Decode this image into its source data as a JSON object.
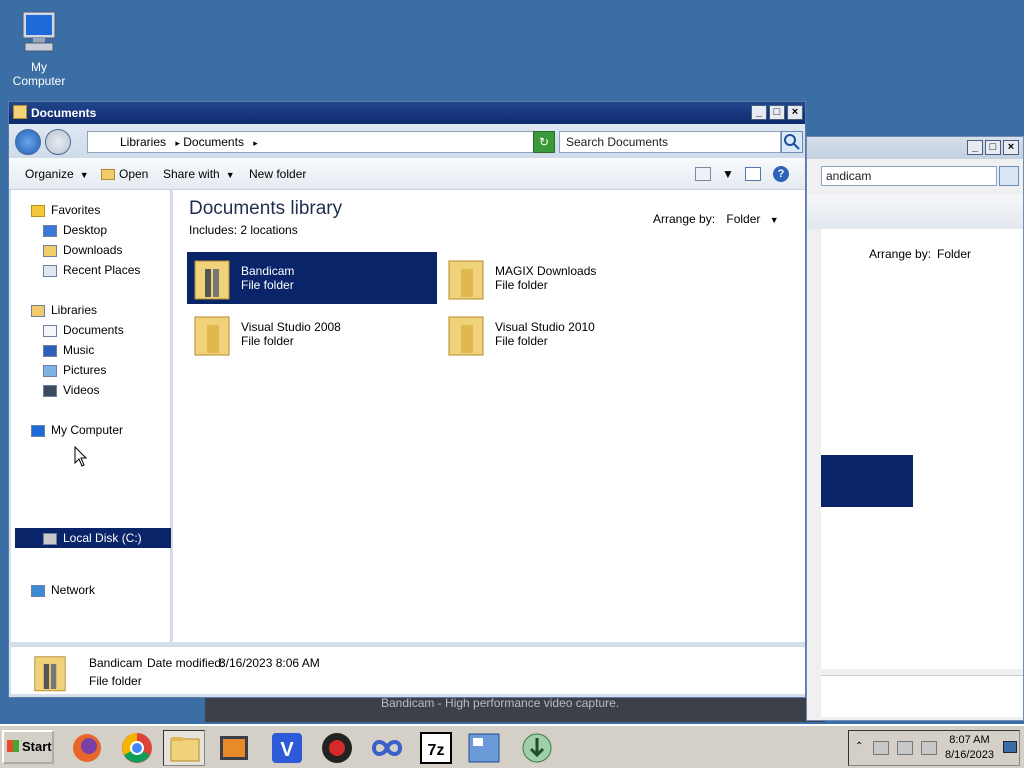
{
  "desktop": {
    "icon_label": "My Computer"
  },
  "bg_window": {
    "search_text": "andicam",
    "arrange_label": "Arrange by:",
    "arrange_value": "Folder"
  },
  "dark_strip": {
    "text": "Bandicam - High performance video capture."
  },
  "window": {
    "title": "Documents",
    "address": {
      "seg1": "Libraries",
      "seg2": "Documents"
    },
    "search_placeholder": "Search Documents",
    "toolbar": {
      "organize": "Organize",
      "open": "Open",
      "share_with": "Share with",
      "new_folder": "New folder"
    },
    "nav": {
      "favorites": "Favorites",
      "desktop": "Desktop",
      "downloads": "Downloads",
      "recent": "Recent Places",
      "libraries": "Libraries",
      "documents": "Documents",
      "music": "Music",
      "pictures": "Pictures",
      "videos": "Videos",
      "computer": "My Computer",
      "local_disk": "Local Disk (C:)",
      "network": "Network"
    },
    "library": {
      "title": "Documents library",
      "includes": "Includes:  2 locations",
      "arrange_label": "Arrange by:",
      "arrange_value": "Folder"
    },
    "items": [
      {
        "name": "Bandicam",
        "type": "File folder"
      },
      {
        "name": "MAGIX Downloads",
        "type": "File folder"
      },
      {
        "name": "Visual Studio 2008",
        "type": "File folder"
      },
      {
        "name": "Visual Studio 2010",
        "type": "File folder"
      }
    ],
    "status": {
      "name": "Bandicam",
      "modified_label": "Date modified:",
      "modified_value": "8/16/2023 8:06 AM",
      "type": "File folder"
    }
  },
  "taskbar": {
    "start": "Start",
    "time": "8:07 AM",
    "date": "8/16/2023",
    "icons": [
      "firefox-icon",
      "chrome-icon",
      "explorer-icon",
      "media-icon",
      "v-app-icon",
      "record-icon",
      "infinity-icon",
      "7zip-icon",
      "network-app-icon",
      "installer-icon"
    ],
    "seven_zip": "7z",
    "v_label": "V"
  },
  "colors": {
    "title": "#0e2a6c",
    "selection": "#0a246a",
    "desktop": "#3a6ea5"
  }
}
